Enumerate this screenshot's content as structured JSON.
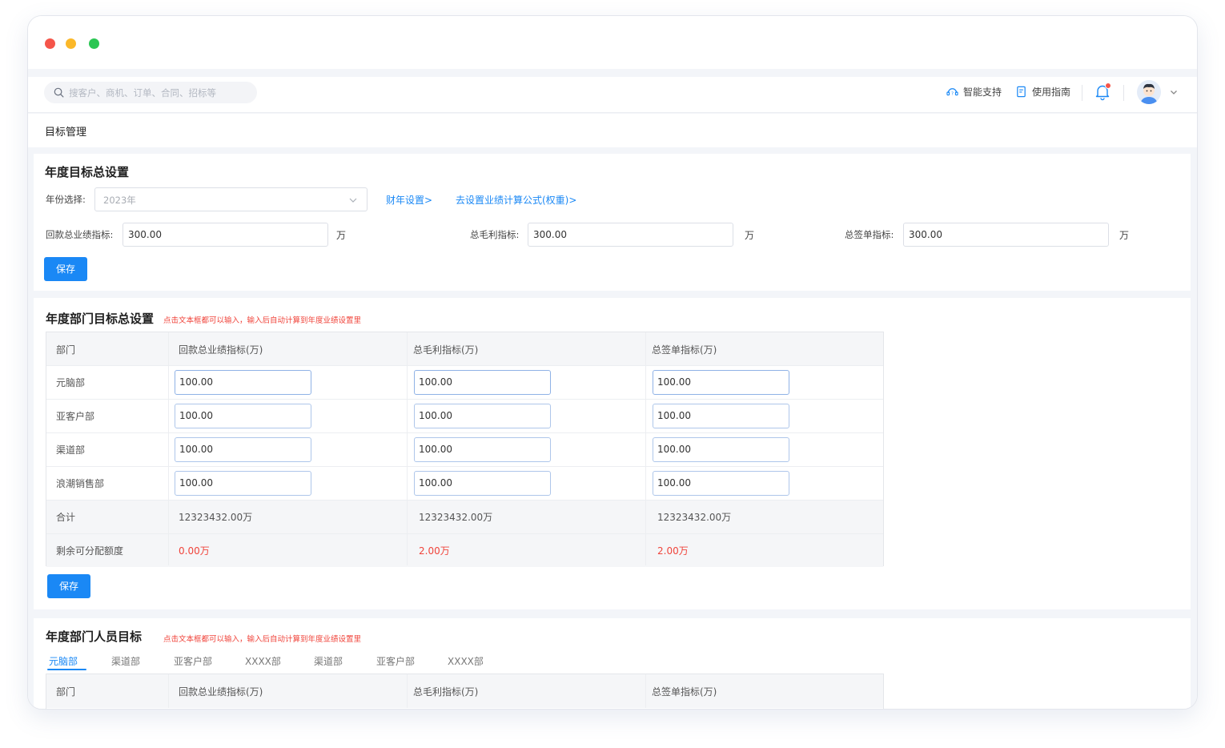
{
  "header": {
    "search_placeholder": "搜客户、商机、订单、合同、招标等",
    "support_label": "智能支持",
    "guide_label": "使用指南"
  },
  "breadcrumb": {
    "title": "目标管理"
  },
  "annual": {
    "title": "年度目标总设置",
    "year_label": "年份选择:",
    "year_value": "2023年",
    "fiscal_link": "财年设置>",
    "formula_link": "去设置业绩计算公式(权重)>",
    "payment_label": "回款总业绩指标:",
    "payment_value": "300.00",
    "profit_label": "总毛利指标:",
    "profit_value": "300.00",
    "sign_label": "总签单指标:",
    "sign_value": "300.00",
    "unit": "万",
    "save_label": "保存"
  },
  "dept": {
    "title": "年度部门目标总设置",
    "hint": "点击文本框都可以输入，输入后自动计算到年度业绩设置里",
    "headers": [
      "部门",
      "回款总业绩指标(万)",
      "总毛利指标(万)",
      "总签单指标(万)"
    ],
    "rows": [
      {
        "name": "元脑部",
        "payment": "100.00",
        "profit": "100.00",
        "sign": "100.00"
      },
      {
        "name": "亚客户部",
        "payment": "100.00",
        "profit": "100.00",
        "sign": "100.00"
      },
      {
        "name": "渠道部",
        "payment": "100.00",
        "profit": "100.00",
        "sign": "100.00"
      },
      {
        "name": "浪潮销售部",
        "payment": "100.00",
        "profit": "100.00",
        "sign": "100.00"
      }
    ],
    "total": {
      "label": "合计",
      "payment": "12323432.00万",
      "profit": "12323432.00万",
      "sign": "12323432.00万"
    },
    "remaining": {
      "label": "剩余可分配额度",
      "payment": "0.00万",
      "profit": "2.00万",
      "sign": "2.00万"
    },
    "save_label": "保存"
  },
  "staff": {
    "title": "年度部门人员目标",
    "hint": "点击文本框都可以输入，输入后自动计算到年度业绩设置里",
    "tabs": [
      "元脑部",
      "渠道部",
      "亚客户部",
      "XXXX部",
      "渠道部",
      "亚客户部",
      "XXXX部"
    ],
    "headers": [
      "部门",
      "回款总业绩指标(万)",
      "总毛利指标(万)",
      "总签单指标(万)"
    ]
  },
  "colors": {
    "primary": "#1a88f5",
    "danger": "#f0443b"
  }
}
